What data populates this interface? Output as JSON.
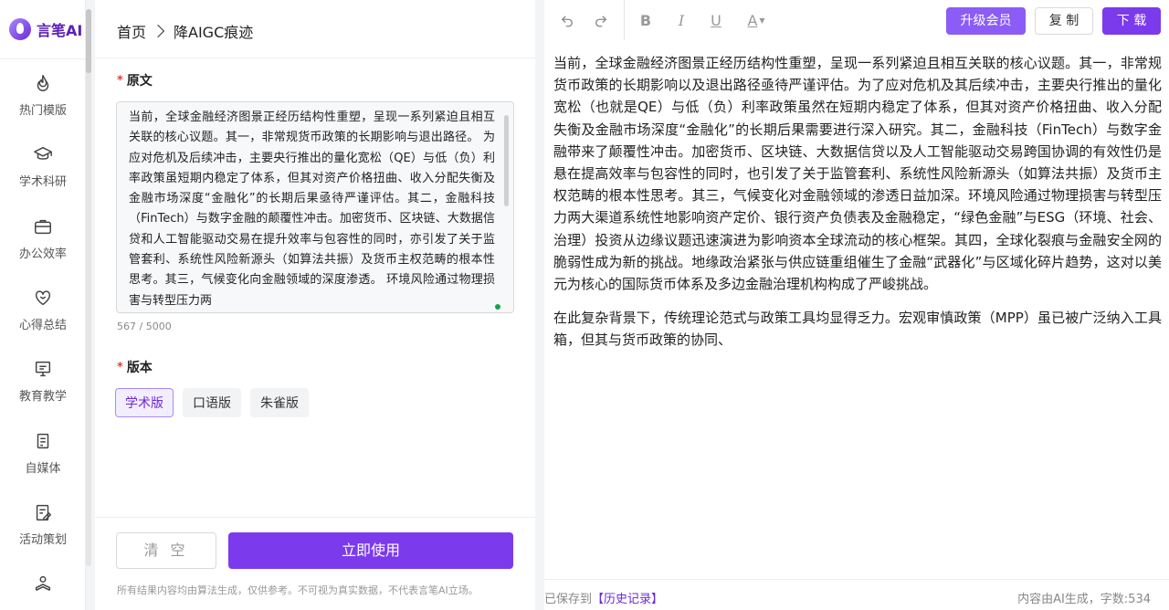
{
  "brand": {
    "name": "言笔AI"
  },
  "sidebar": {
    "items": [
      {
        "label": "热门模版",
        "icon": "flame-icon"
      },
      {
        "label": "学术科研",
        "icon": "graduation-cap-icon"
      },
      {
        "label": "办公效率",
        "icon": "briefcase-icon"
      },
      {
        "label": "心得总结",
        "icon": "heart-icon"
      },
      {
        "label": "教育教学",
        "icon": "presentation-board-icon"
      },
      {
        "label": "自媒体",
        "icon": "document-icon"
      },
      {
        "label": "活动策划",
        "icon": "clipboard-edit-icon"
      },
      {
        "label": "",
        "icon": "reading-person-icon"
      }
    ]
  },
  "breadcrumb": {
    "home": "首页",
    "current": "降AIGC痕迹"
  },
  "form": {
    "source_label": "原文",
    "source_text": "当前，全球金融经济图景正经历结构性重塑，呈现一系列紧迫且相互关联的核心议题。其一，非常规货币政策的长期影响与退出路径。 为应对危机及后续冲击，主要央行推出的量化宽松（QE）与低（负）利率政策虽短期内稳定了体系，但其对资产价格扭曲、收入分配失衡及金融市场深度“金融化”的长期后果亟待严谨评估。其二，金融科技（FinTech）与数字金融的颠覆性冲击。加密货币、区块链、大数据信贷和人工智能驱动交易在提升效率与包容性的同时，亦引发了关于监管套利、系统性风险新源头（如算法共振）及货币主权范畴的根本性思考。其三，气候变化向金融领域的深度渗透。 环境风险通过物理损害与转型压力两",
    "char_count": "567 / 5000",
    "version_label": "版本",
    "versions": [
      "学术版",
      "口语版",
      "朱雀版"
    ],
    "active_version": "学术版",
    "clear_label": "清 空",
    "submit_label": "立即使用",
    "disclaimer": "所有结果内容均由算法生成，仅供参考。不可视为真实数据，不代表言笔AI立场。"
  },
  "toolbar": {
    "bold": "B",
    "italic": "I",
    "underline": "U",
    "font_color": "A",
    "vip_label": "升级会员",
    "copy_label": "复 制",
    "download_label": "下 载"
  },
  "editor": {
    "paragraphs": [
      "当前，全球金融经济图景正经历结构性重塑，呈现一系列紧迫且相互关联的核心议题。其一，非常规货币政策的长期影响以及退出路径亟待严谨评估。为了应对危机及其后续冲击，主要央行推出的量化宽松（也就是QE）与低（负）利率政策虽然在短期内稳定了体系，但其对资产价格扭曲、收入分配失衡及金融市场深度“金融化”的长期后果需要进行深入研究。其二，金融科技（FinTech）与数字金融带来了颠覆性冲击。加密货币、区块链、大数据信贷以及人工智能驱动交易跨国协调的有效性仍是悬在提高效率与包容性的同时，也引发了关于监管套利、系统性风险新源头（如算法共振）及货币主权范畴的根本性思考。其三，气候变化对金融领域的渗透日益加深。环境风险通过物理损害与转型压力两大渠道系统性地影响资产定价、银行资产负债表及金融稳定，“绿色金融”与ESG（环境、社会、治理）投资从边缘议题迅速演进为影响资本全球流动的核心框架。其四，全球化裂痕与金融安全网的脆弱性成为新的挑战。地缘政治紧张与供应链重组催生了金融“武器化”与区域化碎片趋势，这对以美元为核心的国际货币体系及多边金融治理机构构成了严峻挑战。",
      "在此复杂背景下，传统理论范式与政策工具均显得乏力。宏观审慎政策（MPP）虽已被广泛纳入工具箱，但其与货币政策的协同、"
    ]
  },
  "status": {
    "saved_prefix": "已保存到",
    "history_link": "【历史记录】",
    "word_count": "内容由AI生成，字数:534"
  },
  "colors": {
    "accent": "#7c3aed",
    "accent_light": "#8b5cf6"
  }
}
